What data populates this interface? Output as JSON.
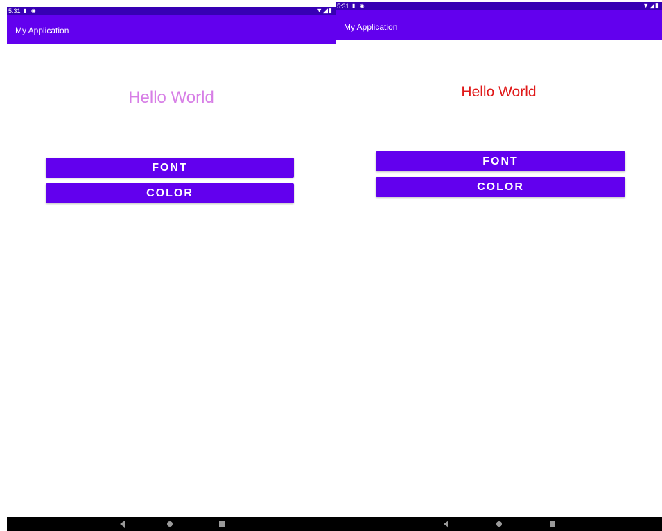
{
  "colors": {
    "status_bar": "#3700b3",
    "app_bar": "#6200ee",
    "button": "#6200ee",
    "hello_left": "#d77ee6",
    "hello_right": "#e01919",
    "nav_bar": "#000000"
  },
  "left": {
    "status": {
      "time": "5:31",
      "icons": [
        "sd-card-icon",
        "sync-icon"
      ],
      "right_icons": [
        "wifi-icon",
        "signal-icon",
        "battery-icon"
      ]
    },
    "app_title": "My Application",
    "hello_text": "Hello World",
    "buttons": {
      "font": "FONT",
      "color": "COLOR"
    },
    "nav": [
      "back-icon",
      "home-icon",
      "recents-icon"
    ]
  },
  "right": {
    "status": {
      "time": "5:31",
      "icons": [
        "sd-card-icon",
        "sync-icon"
      ],
      "right_icons": [
        "wifi-icon",
        "signal-icon",
        "battery-icon"
      ]
    },
    "app_title": "My Application",
    "hello_text": "Hello World",
    "buttons": {
      "font": "FONT",
      "color": "COLOR"
    },
    "nav": [
      "back-icon",
      "home-icon",
      "recents-icon"
    ]
  }
}
